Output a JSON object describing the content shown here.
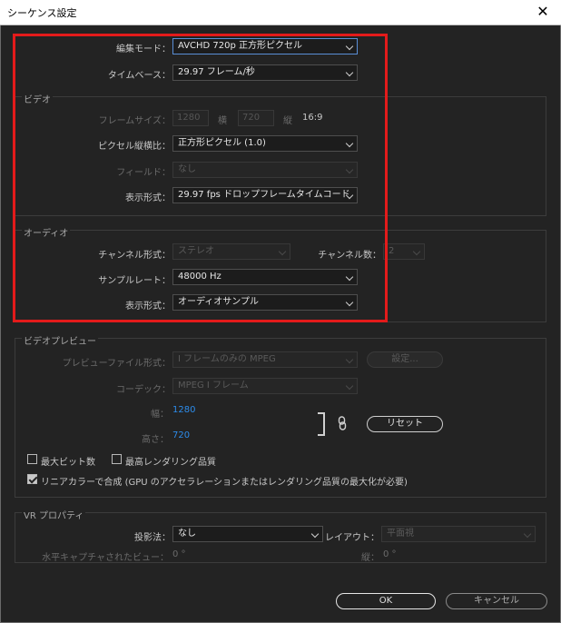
{
  "window": {
    "title": "シーケンス設定",
    "close_glyph": "✕"
  },
  "edit_mode": {
    "label": "編集モード：",
    "value": "AVCHD 720p 正方形ピクセル"
  },
  "timebase": {
    "label": "タイムベース：",
    "value": "29.97  フレーム/秒"
  },
  "video": {
    "section": "ビデオ",
    "frame_size": {
      "label": "フレームサイズ：",
      "width": "1280",
      "width_unit": "横",
      "height": "720",
      "height_unit": "縦",
      "aspect": "16:9"
    },
    "pixel_aspect": {
      "label": "ピクセル縦横比：",
      "value": "正方形ピクセル (1.0)"
    },
    "fields": {
      "label": "フィールド：",
      "value": "なし"
    },
    "display_format": {
      "label": "表示形式：",
      "value": "29.97 fps ドロップフレームタイムコード"
    }
  },
  "audio": {
    "section": "オーディオ",
    "channel_format": {
      "label": "チャンネル形式：",
      "value": "ステレオ"
    },
    "channel_count": {
      "label": "チャンネル数：",
      "value": "2"
    },
    "sample_rate": {
      "label": "サンプルレート：",
      "value": "48000 Hz"
    },
    "display_format": {
      "label": "表示形式：",
      "value": "オーディオサンプル"
    }
  },
  "video_preview": {
    "section": "ビデオプレビュー",
    "preview_file_format": {
      "label": "プレビューファイル形式：",
      "value": "I フレームのみの MPEG"
    },
    "settings_button": "設定...",
    "codec": {
      "label": "コーデック：",
      "value": "MPEG I フレーム"
    },
    "width": {
      "label": "幅：",
      "value": "1280"
    },
    "height": {
      "label": "高さ：",
      "value": "720"
    },
    "reset_button": "リセット",
    "max_bit_depth": {
      "label": "最大ビット数",
      "checked": false
    },
    "max_render_quality": {
      "label": "最高レンダリング品質",
      "checked": false
    },
    "linear_color": {
      "label": "リニアカラーで合成 (GPU のアクセラレーションまたはレンダリング品質の最大化が必要)",
      "checked": true
    }
  },
  "vr": {
    "section": "VR プロパティ",
    "projection": {
      "label": "投影法：",
      "value": "なし"
    },
    "layout": {
      "label": "レイアウト：",
      "value": "平面視"
    },
    "horizontal_view": {
      "label": "水平キャプチャされたビュー：",
      "value": "0 °"
    },
    "vertical": {
      "label": "縦：",
      "value": "0 °"
    }
  },
  "buttons": {
    "ok": "OK",
    "cancel": "キャンセル"
  },
  "colors": {
    "highlight": "#e31b1b",
    "link": "#2d8ceb",
    "background": "#232323"
  },
  "icons": {
    "link": "link-icon",
    "chevron": "chevron-down-icon",
    "close": "close-icon"
  }
}
